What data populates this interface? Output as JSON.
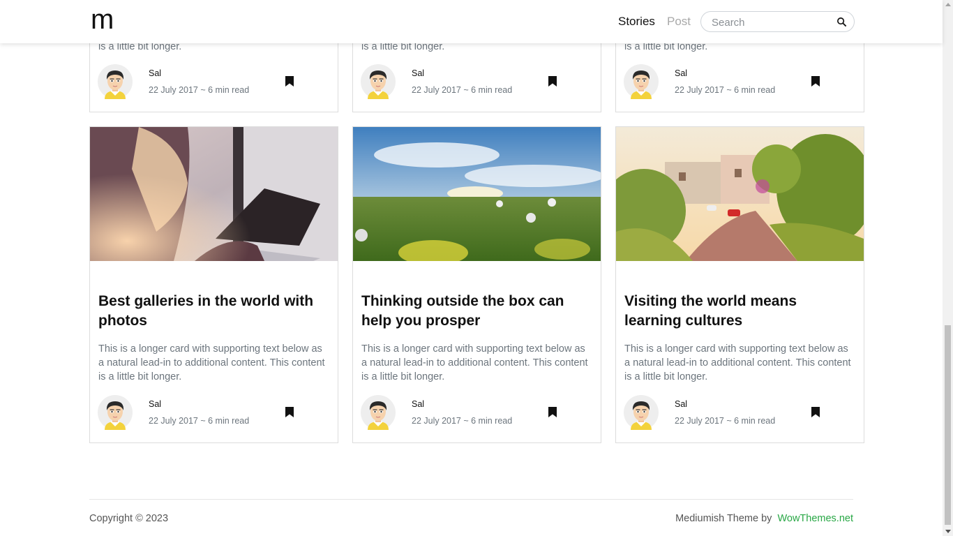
{
  "nav": {
    "brand": "m",
    "links": [
      "Stories",
      "Post"
    ],
    "search_placeholder": "Search"
  },
  "top_cards": [
    {
      "text_tail": "is a little bit longer.",
      "author": "Sal",
      "meta": "22 July 2017 ~ 6 min read"
    },
    {
      "text_tail": "is a little bit longer.",
      "author": "Sal",
      "meta": "22 July 2017 ~ 6 min read"
    },
    {
      "text_tail": "is a little bit longer.",
      "author": "Sal",
      "meta": "22 July 2017 ~ 6 min read"
    }
  ],
  "cards": [
    {
      "title": "Best galleries in the world with photos",
      "text": "This is a longer card with supporting text below as a natural lead-in to additional content. This content is a little bit longer.",
      "author": "Sal",
      "meta": "22 July 2017 ~ 6 min read",
      "image": "laptop-photo"
    },
    {
      "title": "Thinking outside the box can help you prosper",
      "text": "This is a longer card with supporting text below as a natural lead-in to additional content. This content is a little bit longer.",
      "author": "Sal",
      "meta": "22 July 2017 ~ 6 min read",
      "image": "meadow-photo"
    },
    {
      "title": "Visiting the world means learning cultures",
      "text": "This is a longer card with supporting text below as a natural lead-in to additional content. This content is a little bit longer.",
      "author": "Sal",
      "meta": "22 July 2017 ~ 6 min read",
      "image": "street-photo"
    }
  ],
  "footer": {
    "copyright": "Copyright © 2023",
    "credit_prefix": "Mediumish Theme by",
    "credit_link": "WowThemes.net"
  },
  "colors": {
    "accent_link": "#28a745",
    "muted_text": "#6c757d",
    "nav_inactive": "#a9a9a9"
  }
}
